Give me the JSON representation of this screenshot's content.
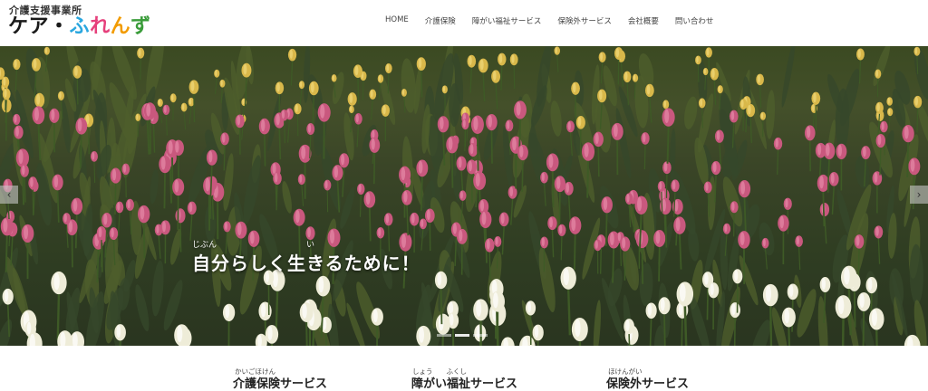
{
  "header": {
    "logo_sub": "介護支援事業所",
    "logo_main": [
      "ケ",
      "ア",
      "・",
      "ふ",
      "れ",
      "ん",
      "ず"
    ],
    "logo_colors": [
      "#1a1a1a",
      "#1a1a1a",
      "#1a1a1a",
      "#2aa7df",
      "#e63f7b",
      "#f29b00",
      "#3a9c3a"
    ]
  },
  "nav": [
    "HOME",
    "介護保険",
    "障がい福祉サービス",
    "保険外サービス",
    "会社概要",
    "問い合わせ"
  ],
  "hero": {
    "headline": "自分らしく生きるために！",
    "ruby_jibun": "じぶん",
    "ruby_i": "い",
    "prev_icon": "chevron-left-icon",
    "next_icon": "chevron-right-icon",
    "prev_glyph": "‹",
    "next_glyph": "›"
  },
  "services": [
    {
      "ruby": "かいごほけん",
      "title": "介護保険サービス"
    },
    {
      "ruby": "しょう　　ふくし",
      "title": "障がい福祉サービス"
    },
    {
      "ruby": "ほけんがい",
      "title": "保険外サービス"
    }
  ]
}
